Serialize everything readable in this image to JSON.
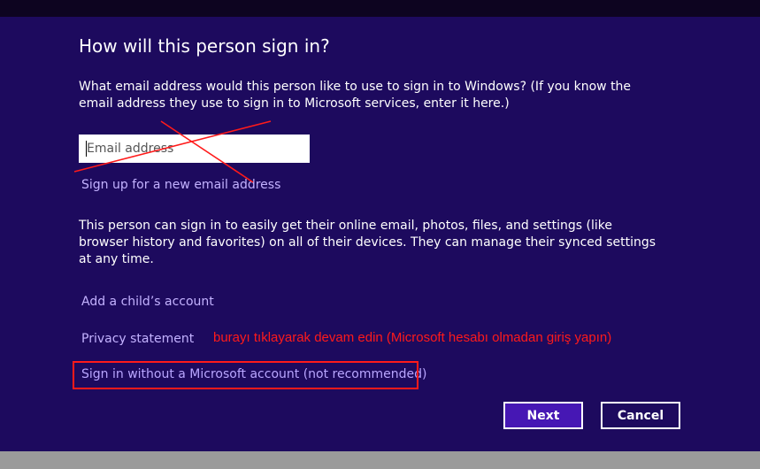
{
  "dialog": {
    "title": "How will this person sign in?",
    "prompt": "What email address would this person like to use to sign in to Windows? (If you know the email address they use to sign in to Microsoft services, enter it here.)",
    "email_placeholder": "Email address",
    "email_value": "",
    "signup_link": "Sign up for a new email address",
    "info": "This person can sign in to easily get their online email, photos, files, and settings (like browser history and favorites) on all of their devices. They can manage their synced settings at any time.",
    "child_link": "Add a child’s account",
    "privacy_link": "Privacy statement",
    "no_msa_link": "Sign in without a Microsoft account (not recommended)",
    "next_label": "Next",
    "cancel_label": "Cancel"
  },
  "annotation": {
    "text": "burayı tıklayarak devam edin (Microsoft hesabı olmadan giriş yapın)",
    "color": "#ff1a1a"
  },
  "colors": {
    "background": "#1d0a5e",
    "link": "#c3b2ff",
    "next_button": "#4617b4"
  }
}
